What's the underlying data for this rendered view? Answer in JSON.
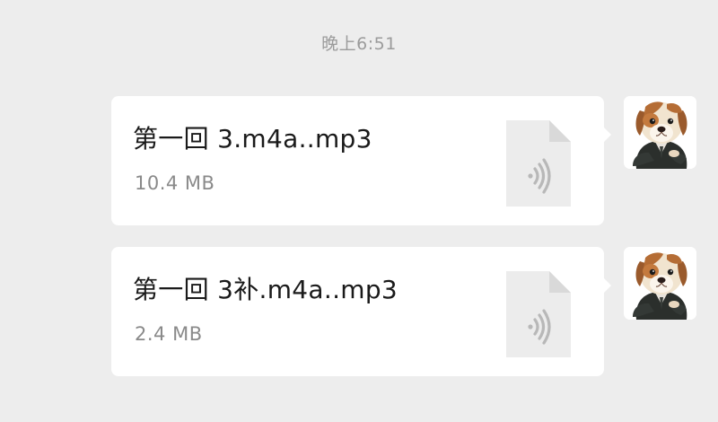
{
  "chat": {
    "timestamp": "晚上6:51",
    "messages": [
      {
        "file_name": "第一回 3.m4a..mp3",
        "file_size": "10.4 MB",
        "file_icon": "audio-file-icon",
        "avatar": "dog-in-suit-avatar"
      },
      {
        "file_name": "第一回 3补.m4a..mp3",
        "file_size": "2.4 MB",
        "file_icon": "audio-file-icon",
        "avatar": "dog-in-suit-avatar"
      }
    ]
  },
  "colors": {
    "background": "#ededed",
    "bubble": "#ffffff",
    "timestamp_text": "#9b9b9b",
    "file_name_text": "#1a1a1a",
    "file_size_text": "#8a8a8a",
    "file_icon_body": "#ececec",
    "file_icon_fold": "#d9d9d9",
    "audio_waves": "#b8b8b8"
  }
}
